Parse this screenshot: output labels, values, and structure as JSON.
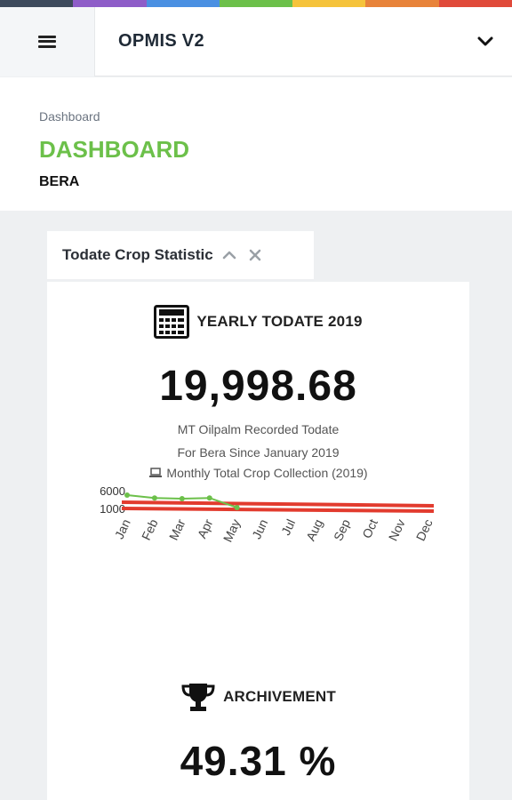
{
  "colors": {
    "stripe": [
      "#3d4a5c",
      "#8e5dc8",
      "#4a90e2",
      "#6cc04a",
      "#f5c33b",
      "#e8833a",
      "#e04a3a"
    ],
    "accent_green": "#6cc04a",
    "chart_line": "#e23b2e",
    "chart_point": "#6cc04a"
  },
  "header": {
    "menu_icon": "hamburger-icon",
    "app_title": "OPMIS V2",
    "dropdown_icon": "chevron-down-icon"
  },
  "page": {
    "breadcrumb": "Dashboard",
    "title": "DASHBOARD",
    "subtitle": "BERA"
  },
  "widget": {
    "tab_label": "Todate Crop Statistic",
    "collapse_icon": "chevron-up-icon",
    "close_icon": "close-icon",
    "yearly": {
      "icon": "calculator-icon",
      "label": "YEARLY TODATE 2019",
      "value": "19,998.68",
      "line1": "MT Oilpalm Recorded Todate",
      "line2": "For Bera Since January 2019",
      "chart_caption_icon": "laptop-icon",
      "chart_caption": "Monthly Total Crop Collection (2019)"
    },
    "achievement": {
      "icon": "trophy-icon",
      "label": "ARCHIVEMENT",
      "value": "49.31 %"
    }
  },
  "chart_data": {
    "type": "line",
    "title": "Monthly Total Crop Collection (2019)",
    "categories": [
      "Jan",
      "Feb",
      "Mar",
      "Apr",
      "May",
      "Jun",
      "Jul",
      "Aug",
      "Sep",
      "Oct",
      "Nov",
      "Dec"
    ],
    "y_ticks": [
      "6000",
      "1000"
    ],
    "series": [
      {
        "values": [
          5000,
          4200,
          4000,
          4200,
          1500,
          null,
          null,
          null,
          null,
          null,
          null,
          null
        ]
      }
    ],
    "ylim": [
      0,
      6000
    ],
    "grid": false,
    "legend": "none"
  }
}
